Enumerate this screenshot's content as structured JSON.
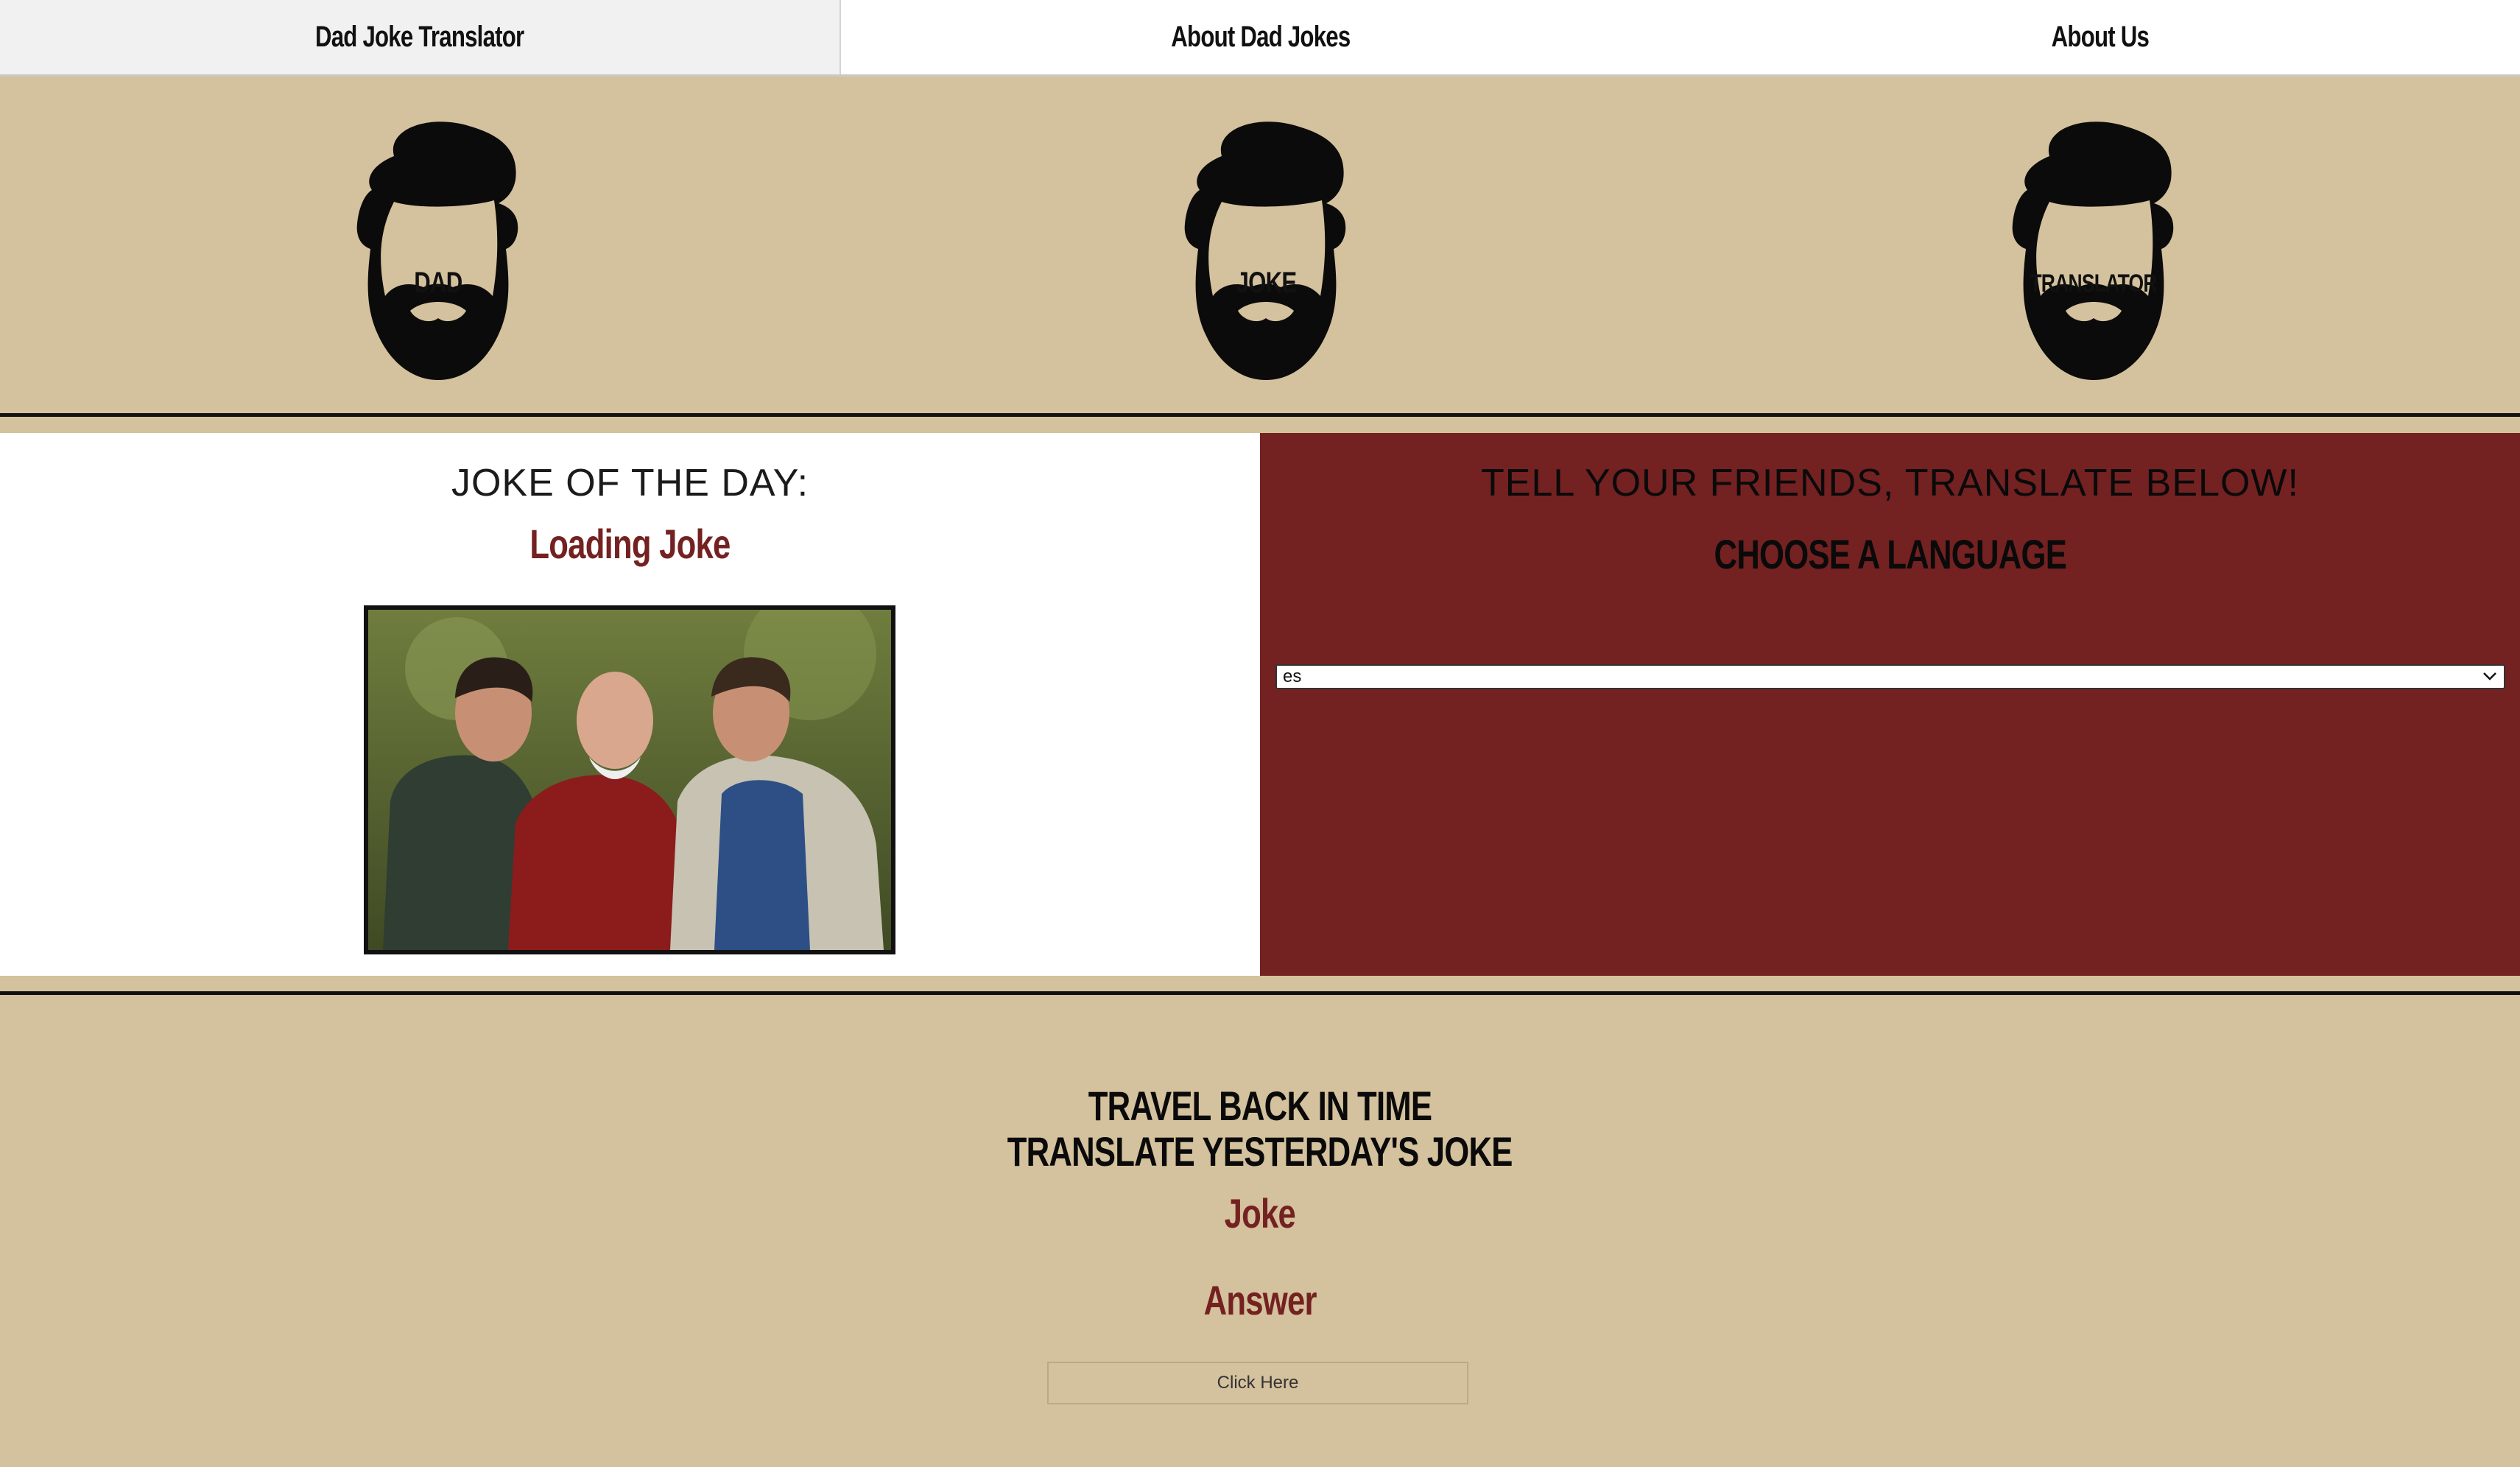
{
  "nav": {
    "tabs": [
      {
        "label": "Dad Joke Translator",
        "active": true
      },
      {
        "label": "About Dad Jokes",
        "active": false
      },
      {
        "label": "About Us",
        "active": false
      }
    ]
  },
  "header": {
    "heads": [
      {
        "label": "DAD",
        "icon": "bearded-head-icon"
      },
      {
        "label": "JOKE",
        "icon": "bearded-head-icon"
      },
      {
        "label": "TRANSLATOR",
        "icon": "bearded-head-icon"
      }
    ]
  },
  "joke_of_day": {
    "title": "JOKE OF THE DAY:",
    "joke": "Loading Joke"
  },
  "translate": {
    "title": "TELL YOUR FRIENDS, TRANSLATE BELOW!",
    "choose": "CHOOSE A LANGUAGE",
    "language_value": "es"
  },
  "yesterday": {
    "line1": "TRAVEL BACK IN TIME",
    "line2": "TRANSLATE YESTERDAY'S JOKE",
    "joke": "Joke",
    "answer": "Answer",
    "button": "Click Here"
  },
  "colors": {
    "tan": "#d4c19d",
    "maroon": "#742121",
    "black": "#111111"
  }
}
